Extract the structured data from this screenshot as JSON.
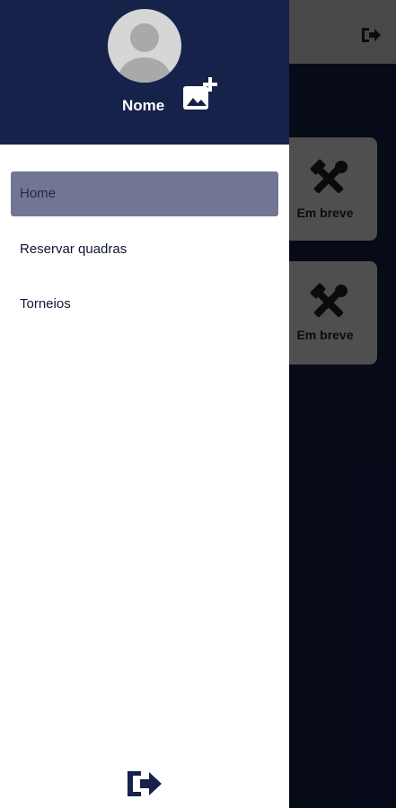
{
  "app": {
    "cards": [
      {
        "label": "Em breve",
        "icon": "tools-icon"
      },
      {
        "label": "Em breve",
        "icon": "tools-icon"
      }
    ],
    "logout_icon": "logout-icon"
  },
  "drawer": {
    "user_name": "Nome",
    "add_photo_icon": "add-photo-icon",
    "menu": [
      {
        "label": "Home",
        "active": true
      },
      {
        "label": "Reservar quadras",
        "active": false
      },
      {
        "label": "Torneios",
        "active": false
      }
    ],
    "logout_icon": "logout-icon"
  },
  "colors": {
    "header": "#17224a",
    "active_item": "#717694",
    "background": "#0b1126",
    "card": "#7a7a7a"
  }
}
